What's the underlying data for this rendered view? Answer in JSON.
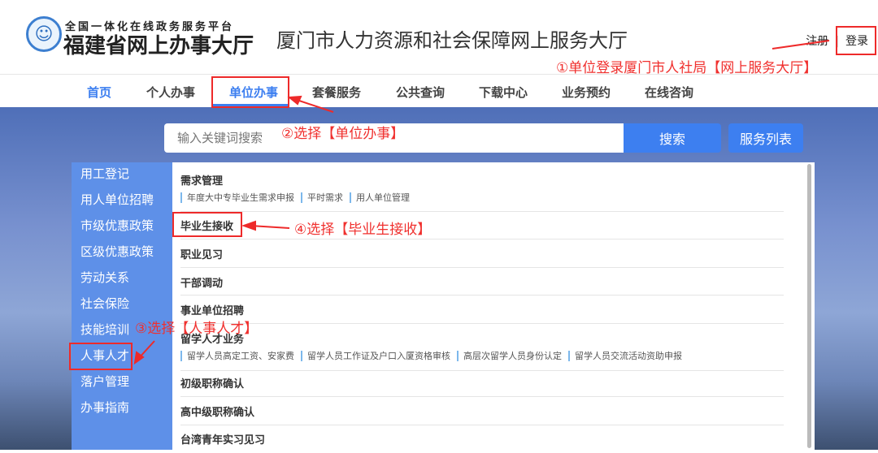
{
  "header": {
    "slogan": "全国一体化在线政务服务平台",
    "brand": "福建省网上办事大厅",
    "site_title": "厦门市人力资源和社会保障网上服务大厅",
    "register": "注册",
    "separator": "|",
    "login": "登录"
  },
  "nav": {
    "items": [
      "首页",
      "个人办事",
      "单位办事",
      "套餐服务",
      "公共查询",
      "下载中心",
      "业务预约",
      "在线咨询"
    ],
    "active": "单位办事"
  },
  "search": {
    "placeholder": "输入关键词搜索",
    "button": "搜索",
    "service_list": "服务列表"
  },
  "sidebar": {
    "items": [
      "用工登记",
      "用人单位招聘",
      "市级优惠政策",
      "区级优惠政策",
      "劳动关系",
      "社会保险",
      "技能培训",
      "人事人才",
      "落户管理",
      "办事指南"
    ],
    "selected": "人事人才"
  },
  "panel": {
    "items": [
      {
        "title": "需求管理",
        "subs": [
          "年度大中专毕业生需求申报",
          "平时需求",
          "用人单位管理"
        ]
      },
      {
        "title": "毕业生接收",
        "subs": []
      },
      {
        "title": "职业见习",
        "subs": []
      },
      {
        "title": "干部调动",
        "subs": []
      },
      {
        "title": "事业单位招聘",
        "subs": []
      },
      {
        "title": "留学人才业务",
        "subs": [
          "留学人员高定工资、安家费",
          "留学人员工作证及户口入厦资格审核",
          "高层次留学人员身份认定",
          "留学人员交流活动资助申报"
        ]
      },
      {
        "title": "初级职称确认",
        "subs": []
      },
      {
        "title": "高中级职称确认",
        "subs": []
      },
      {
        "title": "台湾青年实习见习",
        "subs": []
      }
    ]
  },
  "annotations": {
    "step1": "①单位登录厦门市人社局【网上服务大厅】",
    "step2": "②选择【单位办事】",
    "step3": "③选择【人事人才】",
    "step4": "④选择【毕业生接收】"
  },
  "colors": {
    "accent": "#3d7ff0",
    "sidebar": "#5e90e8",
    "annotation": "#f0302e"
  }
}
